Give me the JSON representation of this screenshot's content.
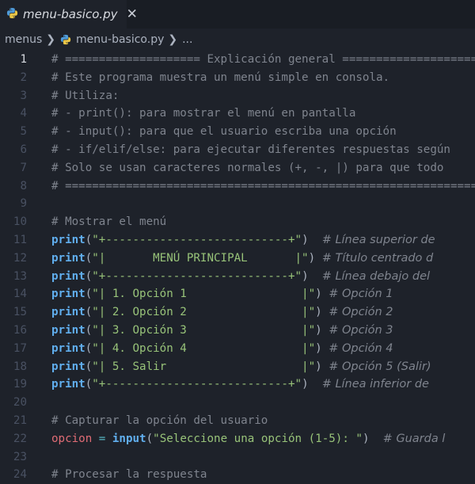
{
  "tab": {
    "title": "menu-basico.py",
    "close": "✕"
  },
  "breadcrumb": {
    "folder": "menus",
    "file": "menu-basico.py",
    "more": "..."
  },
  "lines": [
    {
      "n": "1",
      "active": true,
      "seg": [
        [
          "cmt",
          "# ==================== Explicación general ===================="
        ]
      ]
    },
    {
      "n": "2",
      "seg": [
        [
          "cmt",
          "# Este programa muestra un menú simple en consola."
        ]
      ]
    },
    {
      "n": "3",
      "seg": [
        [
          "cmt",
          "# Utiliza:"
        ]
      ]
    },
    {
      "n": "4",
      "seg": [
        [
          "cmt",
          "# - print(): para mostrar el menú en pantalla"
        ]
      ]
    },
    {
      "n": "5",
      "seg": [
        [
          "cmt",
          "# - input(): para que el usuario escriba una opción"
        ]
      ]
    },
    {
      "n": "6",
      "seg": [
        [
          "cmt",
          "# - if/elif/else: para ejecutar diferentes respuestas según"
        ]
      ]
    },
    {
      "n": "7",
      "seg": [
        [
          "cmt",
          "# Solo se usan caracteres normales (+, -, |) para que todo"
        ]
      ]
    },
    {
      "n": "8",
      "seg": [
        [
          "cmt",
          "# =============================================================="
        ]
      ]
    },
    {
      "n": "9",
      "seg": []
    },
    {
      "n": "10",
      "seg": [
        [
          "cmt",
          "# Mostrar el menú"
        ]
      ]
    },
    {
      "n": "11",
      "seg": [
        [
          "kw",
          "print"
        ],
        [
          "pun",
          "("
        ],
        [
          "str",
          "\"+---------------------------+\""
        ],
        [
          "pun",
          ")  "
        ],
        [
          "cmt-it",
          "# Línea superior de"
        ]
      ]
    },
    {
      "n": "12",
      "seg": [
        [
          "kw",
          "print"
        ],
        [
          "pun",
          "("
        ],
        [
          "str",
          "\"|       MENÚ PRINCIPAL       |\""
        ],
        [
          "pun",
          ") "
        ],
        [
          "cmt-it",
          "# Título centrado d"
        ]
      ]
    },
    {
      "n": "13",
      "seg": [
        [
          "kw",
          "print"
        ],
        [
          "pun",
          "("
        ],
        [
          "str",
          "\"+---------------------------+\""
        ],
        [
          "pun",
          ")  "
        ],
        [
          "cmt-it",
          "# Línea debajo del"
        ]
      ]
    },
    {
      "n": "14",
      "seg": [
        [
          "kw",
          "print"
        ],
        [
          "pun",
          "("
        ],
        [
          "str",
          "\"| 1. Opción 1                 |\""
        ],
        [
          "pun",
          ") "
        ],
        [
          "cmt-it",
          "# Opción 1"
        ]
      ]
    },
    {
      "n": "15",
      "seg": [
        [
          "kw",
          "print"
        ],
        [
          "pun",
          "("
        ],
        [
          "str",
          "\"| 2. Opción 2                 |\""
        ],
        [
          "pun",
          ") "
        ],
        [
          "cmt-it",
          "# Opción 2"
        ]
      ]
    },
    {
      "n": "16",
      "seg": [
        [
          "kw",
          "print"
        ],
        [
          "pun",
          "("
        ],
        [
          "str",
          "\"| 3. Opción 3                 |\""
        ],
        [
          "pun",
          ") "
        ],
        [
          "cmt-it",
          "# Opción 3"
        ]
      ]
    },
    {
      "n": "17",
      "seg": [
        [
          "kw",
          "print"
        ],
        [
          "pun",
          "("
        ],
        [
          "str",
          "\"| 4. Opción 4                 |\""
        ],
        [
          "pun",
          ") "
        ],
        [
          "cmt-it",
          "# Opción 4"
        ]
      ]
    },
    {
      "n": "18",
      "seg": [
        [
          "kw",
          "print"
        ],
        [
          "pun",
          "("
        ],
        [
          "str",
          "\"| 5. Salir                    |\""
        ],
        [
          "pun",
          ") "
        ],
        [
          "cmt-it",
          "# Opción 5 (Salir)"
        ]
      ]
    },
    {
      "n": "19",
      "seg": [
        [
          "kw",
          "print"
        ],
        [
          "pun",
          "("
        ],
        [
          "str",
          "\"+---------------------------+\""
        ],
        [
          "pun",
          ")  "
        ],
        [
          "cmt-it",
          "# Línea inferior de"
        ]
      ]
    },
    {
      "n": "20",
      "seg": []
    },
    {
      "n": "21",
      "seg": [
        [
          "cmt",
          "# Capturar la opción del usuario"
        ]
      ]
    },
    {
      "n": "22",
      "seg": [
        [
          "var",
          "opcion"
        ],
        [
          "pun",
          " "
        ],
        [
          "op",
          "="
        ],
        [
          "pun",
          " "
        ],
        [
          "kw",
          "input"
        ],
        [
          "pun",
          "("
        ],
        [
          "str",
          "\"Seleccione una opción (1-5): \""
        ],
        [
          "pun",
          ")  "
        ],
        [
          "cmt-it",
          "# Guarda l"
        ]
      ]
    },
    {
      "n": "23",
      "seg": []
    },
    {
      "n": "24",
      "seg": [
        [
          "cmt",
          "# Procesar la respuesta"
        ]
      ]
    }
  ]
}
